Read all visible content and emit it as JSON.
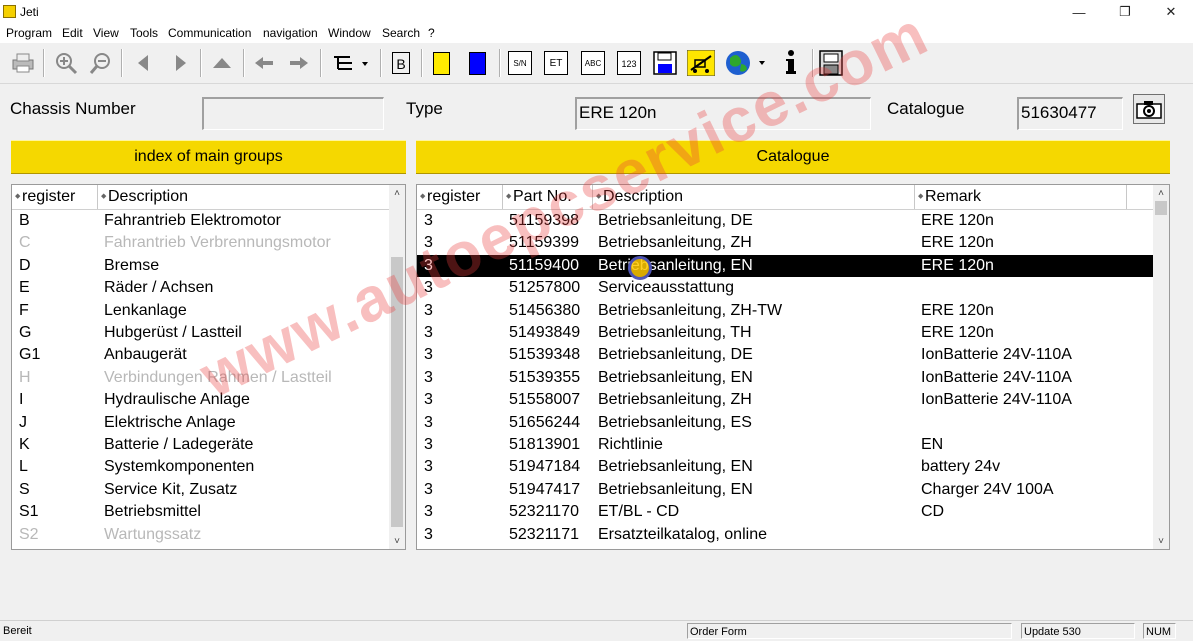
{
  "window": {
    "title": "Jeti",
    "minimize": "—",
    "maximize": "❐",
    "close": "✕"
  },
  "menu": [
    "Program",
    "Edit",
    "View",
    "Tools",
    "Communication",
    "navigation",
    "Window",
    "Search",
    "?"
  ],
  "toolbar": {
    "book_label": "B",
    "serial_label": "S/N",
    "et_label": "ET",
    "abc_label": "ABC",
    "num_label": "123",
    "colors": {
      "yellow": "#ffeb00",
      "blue": "#0000ff",
      "accent": "#f5d800"
    }
  },
  "header": {
    "chassis_label": "Chassis Number",
    "chassis_value": "",
    "type_label": "Type",
    "type_value": "ERE 120n",
    "catalogue_label": "Catalogue",
    "catalogue_value": "51630477"
  },
  "left_panel": {
    "title": "index of main groups",
    "columns": [
      "register",
      "Description"
    ],
    "rows": [
      {
        "register": "B",
        "description": "Fahrantrieb Elektromotor",
        "enabled": true
      },
      {
        "register": "C",
        "description": "Fahrantrieb Verbrennungsmotor",
        "enabled": false
      },
      {
        "register": "D",
        "description": "Bremse",
        "enabled": true
      },
      {
        "register": "E",
        "description": "Räder / Achsen",
        "enabled": true
      },
      {
        "register": "F",
        "description": "Lenkanlage",
        "enabled": true
      },
      {
        "register": "G",
        "description": "Hubgerüst / Lastteil",
        "enabled": true
      },
      {
        "register": "G1",
        "description": "Anbaugerät",
        "enabled": true
      },
      {
        "register": "H",
        "description": "Verbindungen Rahmen / Lastteil",
        "enabled": false
      },
      {
        "register": "I",
        "description": "Hydraulische Anlage",
        "enabled": true
      },
      {
        "register": "J",
        "description": "Elektrische Anlage",
        "enabled": true
      },
      {
        "register": "K",
        "description": "Batterie / Ladegeräte",
        "enabled": true
      },
      {
        "register": "L",
        "description": "Systemkomponenten",
        "enabled": true
      },
      {
        "register": "S",
        "description": "Service Kit, Zusatz",
        "enabled": true
      },
      {
        "register": "S1",
        "description": "Betriebsmittel",
        "enabled": true
      },
      {
        "register": "S2",
        "description": "Wartungssatz",
        "enabled": false
      }
    ]
  },
  "right_panel": {
    "title": "Catalogue",
    "columns": [
      "register",
      "Part No.",
      "Description",
      "Remark"
    ],
    "rows": [
      {
        "register": "3",
        "part_no": "51159398",
        "description": "Betriebsanleitung, DE",
        "remark": "ERE 120n",
        "selected": false
      },
      {
        "register": "3",
        "part_no": "51159399",
        "description": "Betriebsanleitung, ZH",
        "remark": "ERE 120n",
        "selected": false
      },
      {
        "register": "3",
        "part_no": "51159400",
        "description": "Betriebsanleitung, EN",
        "remark": "ERE 120n",
        "selected": true
      },
      {
        "register": "3",
        "part_no": "51257800",
        "description": "Serviceausstattung",
        "remark": "",
        "selected": false
      },
      {
        "register": "3",
        "part_no": "51456380",
        "description": "Betriebsanleitung, ZH-TW",
        "remark": "ERE 120n",
        "selected": false
      },
      {
        "register": "3",
        "part_no": "51493849",
        "description": "Betriebsanleitung, TH",
        "remark": "ERE 120n",
        "selected": false
      },
      {
        "register": "3",
        "part_no": "51539348",
        "description": "Betriebsanleitung, DE",
        "remark": "IonBatterie 24V-110A",
        "selected": false
      },
      {
        "register": "3",
        "part_no": "51539355",
        "description": "Betriebsanleitung, EN",
        "remark": "IonBatterie 24V-110A",
        "selected": false
      },
      {
        "register": "3",
        "part_no": "51558007",
        "description": "Betriebsanleitung, ZH",
        "remark": "IonBatterie 24V-110A",
        "selected": false
      },
      {
        "register": "3",
        "part_no": "51656244",
        "description": "Betriebsanleitung, ES",
        "remark": "",
        "selected": false
      },
      {
        "register": "3",
        "part_no": "51813901",
        "description": "Richtlinie",
        "remark": "EN",
        "selected": false
      },
      {
        "register": "3",
        "part_no": "51947184",
        "description": "Betriebsanleitung, EN",
        "remark": "battery 24v",
        "selected": false
      },
      {
        "register": "3",
        "part_no": "51947417",
        "description": "Betriebsanleitung, EN",
        "remark": "Charger 24V 100A",
        "selected": false
      },
      {
        "register": "3",
        "part_no": "52321170",
        "description": "ET/BL - CD",
        "remark": "CD",
        "selected": false
      },
      {
        "register": "3",
        "part_no": "52321171",
        "description": "Ersatzteilkatalog, online",
        "remark": "",
        "selected": false
      }
    ]
  },
  "watermark": "www.autoepcservice.com",
  "status": {
    "left": "Bereit",
    "order_form": "Order Form",
    "update": "Update 530",
    "num": "NUM"
  }
}
